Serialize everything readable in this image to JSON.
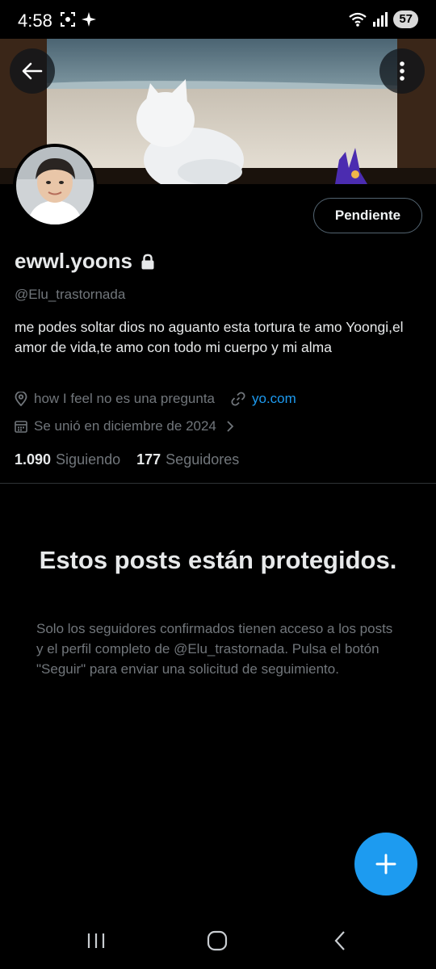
{
  "status_bar": {
    "time": "4:58",
    "battery": "57",
    "icons_left": [
      "screenshot-icon",
      "ai-sparkle-icon"
    ],
    "icons_right": [
      "wifi-icon",
      "signal-icon",
      "battery-icon"
    ]
  },
  "profile": {
    "display_name": "ewwl.yoons",
    "handle": "@Elu_trastornada",
    "bio": "me podes soltar dios no aguanto esta tortura  te amo Yoongi,el amor de vida,te amo con todo mi cuerpo y mi alma",
    "location": "how I feel no es una pregunta",
    "website": "yo.com",
    "joined": "Se unió en diciembre de 2024",
    "following_count": "1.090",
    "following_label": "Siguiendo",
    "followers_count": "177",
    "followers_label": "Seguidores",
    "follow_button_label": "Pendiente"
  },
  "protected": {
    "title": "Estos posts están protegidos.",
    "text": "Solo los seguidores confirmados tienen acceso a los posts y el perfil completo de @Elu_trastornada. Pulsa el botón \"Seguir\" para enviar una solicitud de seguimiento."
  },
  "colors": {
    "background": "#000000",
    "accent": "#1d9bf0",
    "secondary_text": "#71767b",
    "primary_text": "#e7e9ea"
  }
}
